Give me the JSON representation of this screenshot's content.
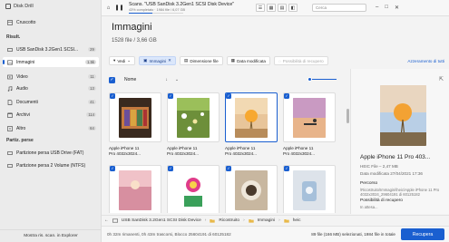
{
  "app": {
    "title": "Disk Drill"
  },
  "sidebar": {
    "top_items": [
      {
        "label": "Cruscotto"
      }
    ],
    "section_results": "Risult.",
    "results_items": [
      {
        "label": "USB  SanDisk 3.2Gen1 SCSI...",
        "count": "29"
      },
      {
        "label": "Immagini",
        "count": "1.5k"
      },
      {
        "label": "Video",
        "count": "11"
      },
      {
        "label": "Audio",
        "count": "13"
      },
      {
        "label": "Documenti",
        "count": "41"
      },
      {
        "label": "Archivi",
        "count": "114"
      },
      {
        "label": "Altro",
        "count": "64"
      }
    ],
    "section_lost": "Partiz. perse",
    "lost_items": [
      {
        "label": "Partizione persa USB Drive (FAT)"
      },
      {
        "label": "Partizione persa 2 Volume (NTFS)"
      }
    ],
    "bottom_button": "Mostra ris. scan. in Explorer"
  },
  "topbar": {
    "scan_title": "Scans. \"USB  SanDisk 3.2Gen1 SCSI Disk Device\"",
    "scan_sub": "43% completato · 1984 file / 6,07 GB",
    "progress": 0.43,
    "search_placeholder": "Cerca"
  },
  "main": {
    "title": "Immagini",
    "subtitle": "1528 file / 3,66 GB",
    "filters": {
      "view": "Vedi",
      "images": "Immagini",
      "size": "Dimensione file",
      "date": "Data modificata",
      "recovery": "Possibilità di recupero",
      "reset": "Azzeramento di tutti"
    },
    "list_header": {
      "name": "Nome"
    },
    "tiles": [
      {
        "caption1": "Apple iPhone 11",
        "caption2": "Pro 4032x3024..."
      },
      {
        "caption1": "Apple iPhone 11",
        "caption2": "Pro 4032x3024..."
      },
      {
        "caption1": "Apple iPhone 11",
        "caption2": "Pro 4032x3024..."
      },
      {
        "caption1": "Apple iPhone 11",
        "caption2": "Pro 4032x3024..."
      },
      {
        "caption1": "",
        "caption2": ""
      },
      {
        "caption1": "",
        "caption2": ""
      },
      {
        "caption1": "",
        "caption2": ""
      },
      {
        "caption1": "",
        "caption2": ""
      }
    ]
  },
  "preview": {
    "title": "Apple iPhone 11 Pro 403...",
    "meta1": "HEIC File – 2,47 MB",
    "meta2": "Data modificata 27/04/2021 17:36",
    "path_label": "Percorso",
    "path_value": "\\Ricostruito\\Immagini\\heic\\Apple iPhone 11 Pro 4032x3024_29604191 di 60125182",
    "recovery_label": "Possibilità di recupero",
    "recovery_value": "In attesa..."
  },
  "breadcrumb": {
    "items": [
      "USB  SanDisk 3.2Gen1 SCSI Disk Device",
      "Ricostruito",
      "Immagini",
      "heic"
    ]
  },
  "statusbar": {
    "left": "0h 32m rimanenti, 0h 43m trascorsi, Blocco 25604191 di 60125182",
    "right": "89 file (166 MB) selezionati, 1984 file in totale",
    "recover": "Recupera"
  }
}
